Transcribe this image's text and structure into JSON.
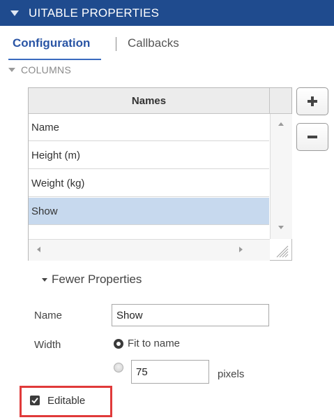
{
  "panel": {
    "title": "UITABLE PROPERTIES"
  },
  "tabs": {
    "configuration": "Configuration",
    "callbacks": "Callbacks",
    "active": "Configuration"
  },
  "columns_section": {
    "label": "COLUMNS",
    "table": {
      "header": "Names",
      "rows": [
        "Name",
        "Height (m)",
        "Weight (kg)",
        "Show"
      ],
      "selected_row": "Show"
    },
    "buttons": {
      "add_icon": "plus-icon",
      "remove_icon": "minus-icon"
    }
  },
  "properties": {
    "toggle_label": "Fewer Properties",
    "name_label": "Name",
    "name_value": "Show",
    "width_label": "Width",
    "width_option_fit": "Fit to name",
    "width_value": "75",
    "width_units": "pixels",
    "editable_label": "Editable",
    "editable_checked": true
  },
  "colors": {
    "header_bg": "#1f4b8e",
    "accent": "#2a55a5",
    "selected_row": "#c7d9ee",
    "highlight_box": "#e03a3a"
  }
}
